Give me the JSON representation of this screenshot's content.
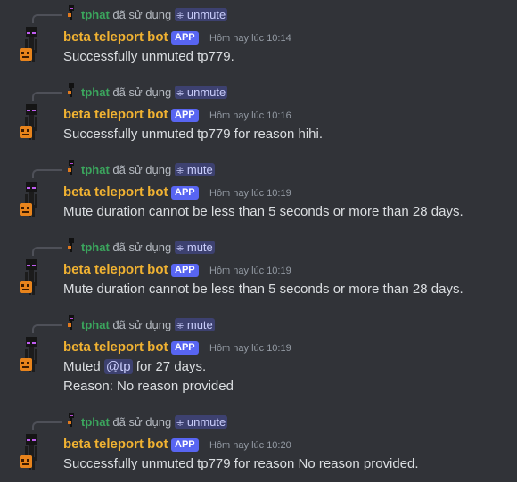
{
  "messages": [
    {
      "user": "tphat",
      "used": "đã sử dụng",
      "command": "unmute",
      "bot": "beta teleport bot",
      "badge": "APP",
      "time": "Hôm nay lúc 10:14",
      "lines": [
        "Successfully unmuted tp779."
      ]
    },
    {
      "user": "tphat",
      "used": "đã sử dụng",
      "command": "unmute",
      "bot": "beta teleport bot",
      "badge": "APP",
      "time": "Hôm nay lúc 10:16",
      "lines": [
        "Successfully unmuted tp779 for reason hihi."
      ]
    },
    {
      "user": "tphat",
      "used": "đã sử dụng",
      "command": "mute",
      "bot": "beta teleport bot",
      "badge": "APP",
      "time": "Hôm nay lúc 10:19",
      "lines": [
        "Mute duration cannot be less than 5 seconds or more than 28 days."
      ]
    },
    {
      "user": "tphat",
      "used": "đã sử dụng",
      "command": "mute",
      "bot": "beta teleport bot",
      "badge": "APP",
      "time": "Hôm nay lúc 10:19",
      "lines": [
        "Mute duration cannot be less than 5 seconds or more than 28 days."
      ]
    },
    {
      "user": "tphat",
      "used": "đã sử dụng",
      "command": "mute",
      "bot": "beta teleport bot",
      "badge": "APP",
      "time": "Hôm nay lúc 10:19",
      "mute_prefix": "Muted",
      "mention": "@tp",
      "mute_suffix": "for 27 days.",
      "reason": "Reason: No reason provided"
    },
    {
      "user": "tphat",
      "used": "đã sử dụng",
      "command": "unmute",
      "bot": "beta teleport bot",
      "badge": "APP",
      "time": "Hôm nay lúc 10:20",
      "lines": [
        "Successfully unmuted tp779 for reason No reason provided."
      ]
    }
  ],
  "colors": {
    "background": "#313338",
    "bot_name": "#f0b232",
    "reply_user": "#3ba55d",
    "badge": "#5865f2",
    "mention": "#c9cdfb"
  },
  "icons": {
    "reply": "reply-spine-icon",
    "command": "slash-command-icon",
    "avatar": "enderman-pumpkin-avatar"
  }
}
